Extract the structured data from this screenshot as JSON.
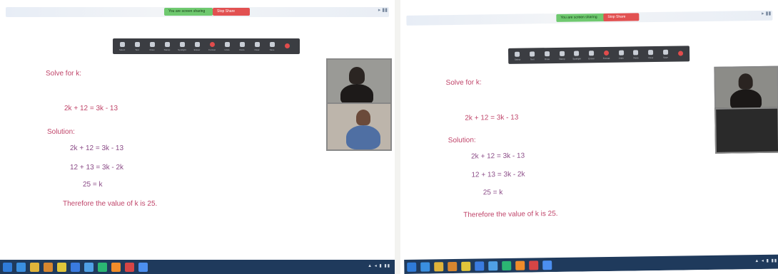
{
  "colors": {
    "taskbar": "#1f3a5c",
    "problem_text": "#c0456a",
    "solution_text": "#8a4a86"
  },
  "left": {
    "share_bar": {
      "green_label": "You are screen sharing",
      "red_label": "Stop Share"
    },
    "toolbar": [
      {
        "label": "Select",
        "icon": "cursor-icon"
      },
      {
        "label": "Text",
        "icon": "text-icon"
      },
      {
        "label": "Draw",
        "icon": "pen-icon"
      },
      {
        "label": "Stamp",
        "icon": "stamp-icon"
      },
      {
        "label": "Spotlight",
        "icon": "spotlight-icon"
      },
      {
        "label": "Eraser",
        "icon": "eraser-icon"
      },
      {
        "label": "Format",
        "icon": "format-icon",
        "red": true
      },
      {
        "label": "Undo",
        "icon": "undo-icon"
      },
      {
        "label": "Redo",
        "icon": "redo-icon"
      },
      {
        "label": "Clear",
        "icon": "trash-icon"
      },
      {
        "label": "Save",
        "icon": "save-icon"
      },
      {
        "label": "",
        "icon": "close-icon",
        "red": true
      }
    ],
    "problem_label": "Solve for k:",
    "equation": "2k + 12 = 3k - 13",
    "solution_label": "Solution:",
    "steps": [
      "2k + 12 = 3k - 13",
      "12 + 13 = 3k - 2k",
      "25 = k"
    ],
    "conclusion": "Therefore the value of k is 25."
  },
  "right": {
    "share_bar": {
      "green_label": "You are screen sharing",
      "red_label": "Stop Share"
    },
    "problem_label": "Solve for k:",
    "equation": "2k + 12 = 3k - 13",
    "solution_label": "Solution:",
    "steps": [
      "2k + 12 = 3k - 13",
      "12 + 13 = 3k - 2k",
      "25 = k"
    ],
    "conclusion": "Therefore the value of k is 25."
  }
}
